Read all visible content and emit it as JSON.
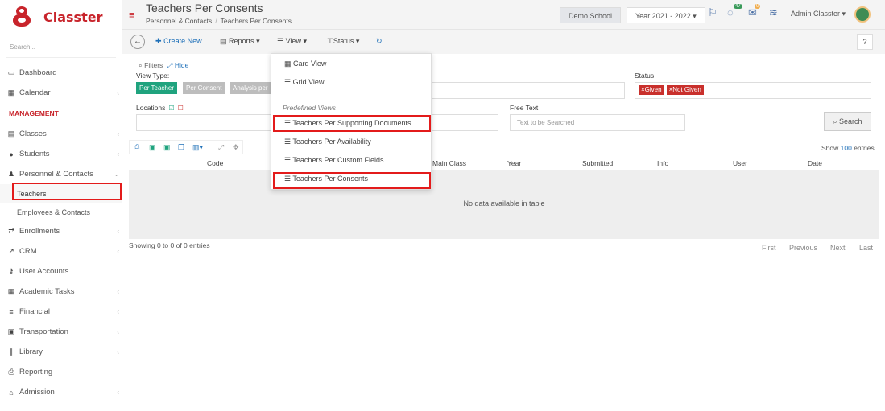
{
  "app": {
    "brand": "Classter"
  },
  "sidebar": {
    "search_placeholder": "Search...",
    "items": [
      {
        "label": "Dashboard",
        "icon": "monitor-icon"
      },
      {
        "label": "Calendar",
        "icon": "calendar-icon"
      }
    ],
    "section_heading": "MANAGEMENT",
    "management_items": [
      {
        "label": "Classes",
        "icon": "classes-icon"
      },
      {
        "label": "Students",
        "icon": "students-icon"
      },
      {
        "label": "Personnel & Contacts",
        "icon": "personnel-icon"
      }
    ],
    "sub_items": [
      {
        "label": "Teachers"
      },
      {
        "label": "Employees & Contacts"
      }
    ],
    "more_items": [
      {
        "label": "Enrollments",
        "icon": "enrollments-icon"
      },
      {
        "label": "CRM",
        "icon": "crm-icon"
      },
      {
        "label": "User Accounts",
        "icon": "key-icon"
      },
      {
        "label": "Academic Tasks",
        "icon": "tasks-icon"
      },
      {
        "label": "Financial",
        "icon": "financial-icon"
      },
      {
        "label": "Transportation",
        "icon": "bus-icon"
      },
      {
        "label": "Library",
        "icon": "library-icon"
      },
      {
        "label": "Reporting",
        "icon": "printer-icon"
      },
      {
        "label": "Admission",
        "icon": "bank-icon"
      }
    ]
  },
  "header": {
    "title": "Teachers Per Consents",
    "breadcrumb": [
      "Personnel & Contacts",
      "Teachers Per Consents"
    ],
    "school": "Demo School",
    "year": "Year 2021 - 2022",
    "notif_count": "47",
    "mail_count": "0",
    "user": "Admin Classter"
  },
  "toolbar": {
    "create_new": "Create New",
    "reports": "Reports",
    "view": "View",
    "status": "Status",
    "help": "?"
  },
  "filters": {
    "toggle_label": "Filters",
    "hide_label": "Hide",
    "view_type_label": "View Type:",
    "view_types": [
      "Per Teacher",
      "Per Consent",
      "Analysis per"
    ],
    "status_label": "Status",
    "status_tags": [
      "Given",
      "Not Given"
    ],
    "locations_label": "Locations",
    "free_text_label": "Free Text",
    "free_text_placeholder": "Text to be Searched",
    "search_button": "Search"
  },
  "table": {
    "show_prefix": "Show",
    "show_count": "100",
    "show_suffix": "entries",
    "columns": [
      "Code",
      "Main Class",
      "Year",
      "Submitted",
      "Info",
      "User",
      "Date"
    ],
    "empty_message": "No data available in table",
    "showing": "Showing 0 to 0 of 0 entries",
    "pager": [
      "First",
      "Previous",
      "Next",
      "Last"
    ]
  },
  "view_menu": {
    "items": [
      "Card View",
      "Grid View"
    ],
    "predefined_heading": "Predefined Views",
    "predefined": [
      "Teachers Per Supporting Documents",
      "Teachers Per Availability",
      "Teachers Per Custom Fields",
      "Teachers Per Consents"
    ]
  },
  "colors": {
    "brand": "#c8242b",
    "link": "#1d6fb8",
    "active_view_type": "#1fa37e",
    "inactive_view_type": "#bdbdbd",
    "highlight": "#e31b1b"
  }
}
